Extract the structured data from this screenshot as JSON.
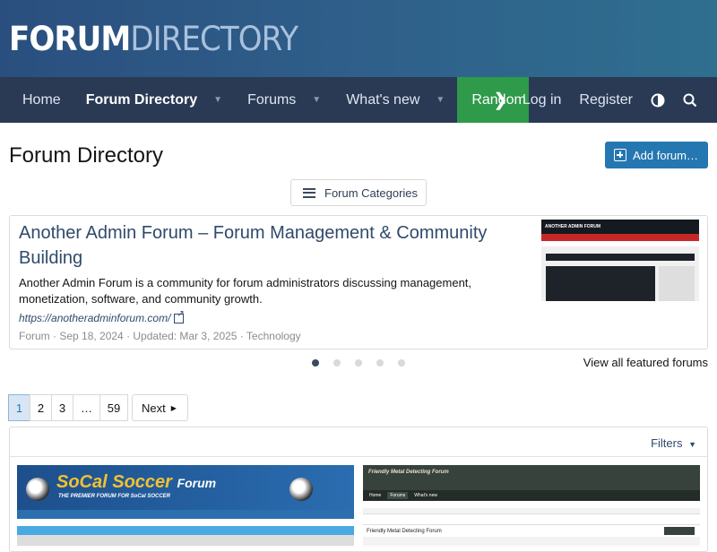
{
  "header": {
    "logo_part1": "FORUM",
    "logo_part2": "DIRECTORY"
  },
  "nav": {
    "items": [
      {
        "label": "Home"
      },
      {
        "label": "Forum Directory"
      },
      {
        "label": "Forums"
      },
      {
        "label": "What's new"
      },
      {
        "label": "Random"
      }
    ],
    "login": "Log in",
    "register": "Register"
  },
  "page": {
    "title": "Forum Directory",
    "add_button": "Add forum…",
    "categories_button": "Forum Categories"
  },
  "featured": {
    "title": "Another Admin Forum – Forum Management & Community Building",
    "description": "Another Admin Forum is a community for forum administrators discussing management, monetization, software, and community growth.",
    "url": "https://anotheradminforum.com/",
    "meta": "Forum · Sep 18, 2024 · Updated: Mar 3, 2025 · Technology",
    "thumb_title": "ANOTHER ADMIN FORUM",
    "slides_total": 5,
    "slide_active": 1,
    "view_all": "View all featured forums"
  },
  "pagination": {
    "pages": [
      "1",
      "2",
      "3",
      "…",
      "59"
    ],
    "current": "1",
    "next": "Next"
  },
  "list": {
    "filters": "Filters",
    "cards": [
      {
        "thumb_logo": "SoCal Soccer",
        "thumb_logo_suffix": "Forum",
        "thumb_tagline": "THE PREMIER FORUM FOR SoCal SOCCER"
      },
      {
        "thumb_logo": "Friendly Metal Detecting Forum",
        "thumb_page_title": "Friendly Metal Detecting Forum",
        "thumb_tabs": [
          "Home",
          "Forums",
          "What's new"
        ]
      }
    ]
  },
  "colors": {
    "nav_bg": "#2a3a55",
    "random_bg": "#2e9a4a",
    "accent": "#2577b1"
  }
}
